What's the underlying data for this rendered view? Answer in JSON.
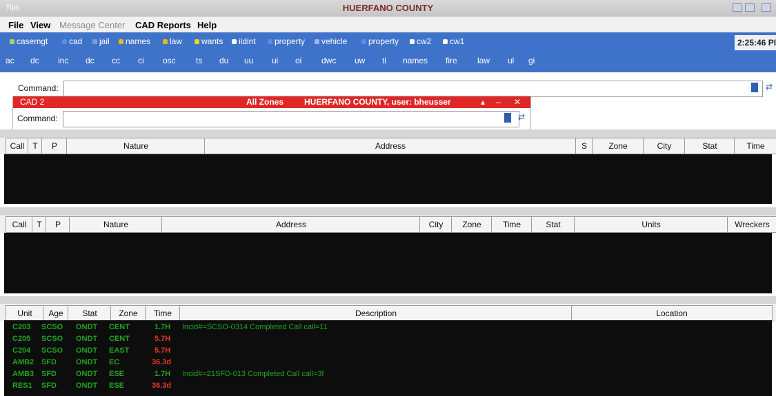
{
  "window": {
    "app_label": "Tips",
    "title": "HUERFANO COUNTY"
  },
  "menu": {
    "file": "File",
    "view": "View",
    "message_center": "Message Center",
    "cad_reports": "CAD Reports",
    "help": "Help"
  },
  "toolbar_row1": [
    "casemgt",
    "cad",
    "jail",
    "names",
    "law",
    "wants",
    "ildint",
    "property",
    "vehicle",
    "property",
    "cw2",
    "cw1"
  ],
  "toolbar_row2": [
    "ac",
    "dc",
    "inc",
    "dc",
    "cc",
    "ci",
    "osc",
    "ts",
    "du",
    "uu",
    "ui",
    "oi",
    "dwc",
    "uw",
    "ti",
    "names",
    "fire",
    "law",
    "ul",
    "gi"
  ],
  "clock": "2:25:46 PI",
  "command": {
    "label": "Command:",
    "value": ""
  },
  "cad2": {
    "title": "CAD 2",
    "zones": "All Zones",
    "county_user": "HUERFANO COUNTY, user: bheusser",
    "command_label": "Command:"
  },
  "calls_grid": {
    "columns": [
      "Call",
      "T",
      "P",
      "Nature",
      "Address",
      "S",
      "Zone",
      "City",
      "Stat",
      "Time"
    ]
  },
  "pending_grid": {
    "columns": [
      "Call",
      "T",
      "P",
      "Nature",
      "Address",
      "City",
      "Zone",
      "Time",
      "Stat",
      "Units",
      "Wreckers"
    ]
  },
  "units_grid": {
    "columns": [
      "Unit",
      "Age",
      "Stat",
      "Zone",
      "Time",
      "Description",
      "Location"
    ],
    "rows": [
      {
        "unit": "C203",
        "agency": "SCSO",
        "stat": "ONDT",
        "zone": "CENT",
        "time": "1.7H",
        "time_color": "green",
        "description": "Incid#=SCSO-0314 Completed Call call=11"
      },
      {
        "unit": "C205",
        "agency": "SCSO",
        "stat": "ONDT",
        "zone": "CENT",
        "time": "5.7H",
        "time_color": "red",
        "description": ""
      },
      {
        "unit": "C204",
        "agency": "SCSO",
        "stat": "ONDT",
        "zone": "EAST",
        "time": "5.7H",
        "time_color": "red",
        "description": ""
      },
      {
        "unit": "AMB2",
        "agency": "SFD",
        "stat": "ONDT",
        "zone": "EC",
        "time": "36.3d",
        "time_color": "red",
        "description": ""
      },
      {
        "unit": "AMB3",
        "agency": "SFD",
        "stat": "ONDT",
        "zone": "ESE",
        "time": "1.7H",
        "time_color": "green",
        "description": "Incid#=21SFD-013 Completed Call call=3f"
      },
      {
        "unit": "RES1",
        "agency": "SFD",
        "stat": "ONDT",
        "zone": "ESE",
        "time": "36.3d",
        "time_color": "red",
        "description": ""
      }
    ]
  },
  "colors": {
    "toolbar": "#3f73c9",
    "cad2_bar": "#e02727",
    "grid_body": "#0d0d0d",
    "status_ok": "#1fa51f",
    "status_alert": "#e03a27"
  }
}
